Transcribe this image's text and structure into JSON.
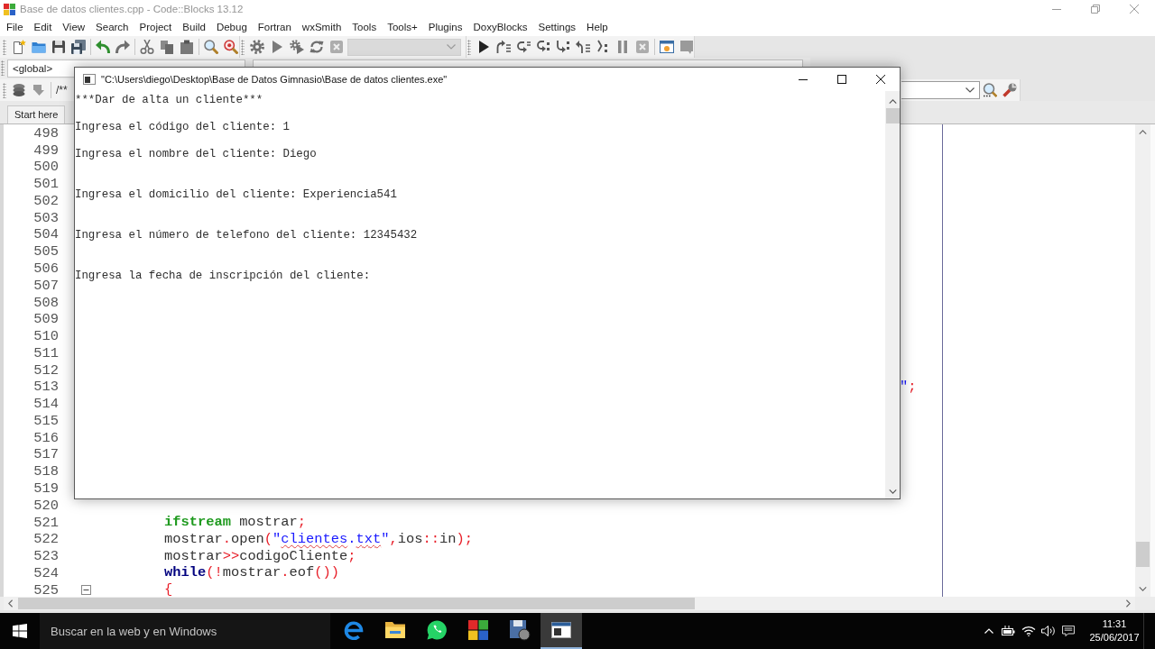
{
  "window": {
    "title": "Base de datos clientes.cpp - Code::Blocks 13.12"
  },
  "menu": [
    "File",
    "Edit",
    "View",
    "Search",
    "Project",
    "Build",
    "Debug",
    "Fortran",
    "wxSmith",
    "Tools",
    "Tools+",
    "Plugins",
    "DoxyBlocks",
    "Settings",
    "Help"
  ],
  "toolbars": {
    "build_target": {
      "disabled": true
    },
    "scope": {
      "value": "<global>"
    },
    "doxyblocks": {
      "label": "/**"
    }
  },
  "tabs": [
    {
      "label": "Start here",
      "selected": false
    }
  ],
  "editor": {
    "rows": [
      {
        "number": "498",
        "kind": "covered",
        "fold_marker": false
      },
      {
        "number": "499",
        "kind": "covered",
        "fold_marker": false
      },
      {
        "number": "500",
        "kind": "covered",
        "fold_marker": false
      },
      {
        "number": "501",
        "kind": "covered",
        "fold_marker": false
      },
      {
        "number": "502",
        "kind": "covered",
        "fold_marker": false
      },
      {
        "number": "503",
        "kind": "covered",
        "fold_marker": false
      },
      {
        "number": "504",
        "kind": "covered",
        "fold_marker": false
      },
      {
        "number": "505",
        "kind": "covered",
        "fold_marker": false
      },
      {
        "number": "506",
        "kind": "covered",
        "fold_marker": false
      },
      {
        "number": "507",
        "kind": "covered",
        "fold_marker": false
      },
      {
        "number": "508",
        "kind": "covered",
        "fold_marker": false
      },
      {
        "number": "509",
        "kind": "covered",
        "fold_marker": false
      },
      {
        "number": "510",
        "kind": "covered",
        "fold_marker": false
      },
      {
        "number": "511",
        "kind": "covered",
        "fold_marker": false
      },
      {
        "number": "512",
        "kind": "covered",
        "fold_marker": false
      },
      {
        "number": "513",
        "kind": "tail",
        "fold_marker": false,
        "code": [
          {
            "kind": "string",
            "text": "\""
          },
          {
            "kind": "operator",
            "text": ";"
          }
        ]
      },
      {
        "number": "514",
        "kind": "covered",
        "fold_marker": false
      },
      {
        "number": "515",
        "kind": "covered",
        "fold_marker": false
      },
      {
        "number": "516",
        "kind": "covered",
        "fold_marker": false
      },
      {
        "number": "517",
        "kind": "covered",
        "fold_marker": false
      },
      {
        "number": "518",
        "kind": "covered",
        "fold_marker": false
      },
      {
        "number": "519",
        "kind": "covered",
        "fold_marker": false
      },
      {
        "number": "520",
        "kind": "blank",
        "fold_marker": false
      },
      {
        "number": "521",
        "kind": "code",
        "fold_marker": false,
        "code": [
          {
            "kind": "type",
            "text": "ifstream"
          },
          {
            "kind": "plain",
            "text": " mostrar"
          },
          {
            "kind": "operator",
            "text": ";"
          }
        ]
      },
      {
        "number": "522",
        "kind": "code",
        "fold_marker": false,
        "code": [
          {
            "kind": "plain",
            "text": "mostrar"
          },
          {
            "kind": "operator",
            "text": "."
          },
          {
            "kind": "plain",
            "text": "open"
          },
          {
            "kind": "operator",
            "text": "("
          },
          {
            "kind": "string",
            "text": "\""
          },
          {
            "kind": "flagged",
            "text": "clientes"
          },
          {
            "kind": "string",
            "text": "."
          },
          {
            "kind": "flagged",
            "text": "txt"
          },
          {
            "kind": "string",
            "text": "\""
          },
          {
            "kind": "operator",
            "text": ","
          },
          {
            "kind": "plain",
            "text": "ios"
          },
          {
            "kind": "operator",
            "text": "::"
          },
          {
            "kind": "plain",
            "text": "in"
          },
          {
            "kind": "operator",
            "text": ");"
          }
        ]
      },
      {
        "number": "523",
        "kind": "code",
        "fold_marker": false,
        "code": [
          {
            "kind": "plain",
            "text": "mostrar"
          },
          {
            "kind": "operator",
            "text": ">>"
          },
          {
            "kind": "plain",
            "text": "codigoCliente"
          },
          {
            "kind": "operator",
            "text": ";"
          }
        ]
      },
      {
        "number": "524",
        "kind": "code",
        "fold_marker": false,
        "code": [
          {
            "kind": "keyword",
            "text": "while"
          },
          {
            "kind": "operator",
            "text": "(!"
          },
          {
            "kind": "plain",
            "text": "mostrar"
          },
          {
            "kind": "operator",
            "text": "."
          },
          {
            "kind": "plain",
            "text": "eof"
          },
          {
            "kind": "operator",
            "text": "())"
          }
        ]
      },
      {
        "number": "525",
        "kind": "code",
        "fold_marker": true,
        "code": [
          {
            "kind": "operator",
            "text": "{"
          }
        ]
      }
    ]
  },
  "console": {
    "title": "\"C:\\Users\\diego\\Desktop\\Base de Datos Gimnasio\\Base de datos clientes.exe\"",
    "output": "***Dar de alta un cliente***\n\nIngresa el código del cliente: 1\n\nIngresa el nombre del cliente: Diego\n\n\nIngresa el domicilio del cliente: Experiencia541\n\n\nIngresa el número de telefono del cliente: 12345432\n\n\nIngresa la fecha de inscripción del cliente:"
  },
  "taskbar": {
    "search": {
      "placeholder": "Buscar en la web y en Windows"
    },
    "apps": [
      {
        "kind": "browser",
        "selected": false
      },
      {
        "kind": "files",
        "selected": false
      },
      {
        "kind": "messenger",
        "selected": false
      },
      {
        "kind": "ide",
        "selected": false
      },
      {
        "kind": "disk",
        "selected": false
      },
      {
        "kind": "console",
        "selected": true
      }
    ],
    "clock": {
      "time": "11:31",
      "date": "25/06/2017"
    }
  }
}
